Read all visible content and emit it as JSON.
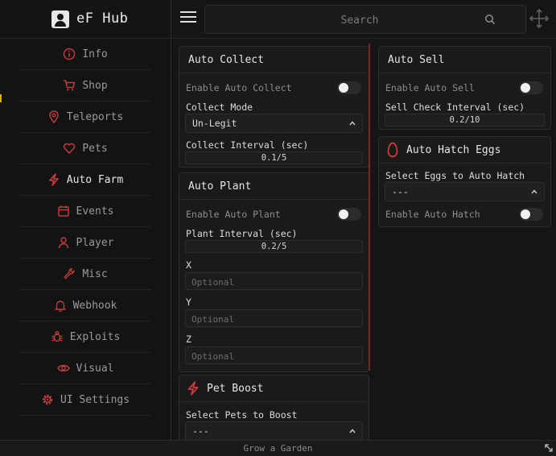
{
  "app": {
    "title": "eF Hub",
    "footer": "Grow a Garden"
  },
  "search": {
    "placeholder": "Search"
  },
  "colors": {
    "accent": "#c23b3b",
    "background": "#151515",
    "panel": "#1a1a1a"
  },
  "sidebar": {
    "items": [
      {
        "label": "Info",
        "icon": "info-icon"
      },
      {
        "label": "Shop",
        "icon": "cart-icon"
      },
      {
        "label": "Teleports",
        "icon": "map-pin-icon"
      },
      {
        "label": "Pets",
        "icon": "heart-icon"
      },
      {
        "label": "Auto Farm",
        "icon": "lightning-icon",
        "active": true
      },
      {
        "label": "Events",
        "icon": "calendar-icon"
      },
      {
        "label": "Player",
        "icon": "user-icon"
      },
      {
        "label": "Misc",
        "icon": "wrench-icon"
      },
      {
        "label": "Webhook",
        "icon": "bell-icon"
      },
      {
        "label": "Exploits",
        "icon": "bug-icon"
      },
      {
        "label": "Visual",
        "icon": "eye-icon"
      },
      {
        "label": "UI Settings",
        "icon": "gear-icon"
      }
    ]
  },
  "auto_collect": {
    "title": "Auto Collect",
    "enable_label": "Enable Auto Collect",
    "mode_label": "Collect Mode",
    "mode_value": "Un-Legit",
    "interval_label": "Collect Interval (sec)",
    "interval_value": "0.1/5"
  },
  "auto_plant": {
    "title": "Auto Plant",
    "enable_label": "Enable Auto Plant",
    "interval_label": "Plant Interval (sec)",
    "interval_value": "0.2/5",
    "x_label": "X",
    "y_label": "Y",
    "z_label": "Z",
    "placeholder": "Optional"
  },
  "pet_boost": {
    "title": "Pet Boost",
    "select_label": "Select Pets to Boost",
    "select_value": "---"
  },
  "auto_sell": {
    "title": "Auto Sell",
    "enable_label": "Enable Auto Sell",
    "interval_label": "Sell Check Interval (sec)",
    "interval_value": "0.2/10"
  },
  "auto_hatch": {
    "title": "Auto Hatch Eggs",
    "select_label": "Select Eggs to Auto Hatch",
    "select_value": "---",
    "enable_label": "Enable Auto Hatch"
  }
}
